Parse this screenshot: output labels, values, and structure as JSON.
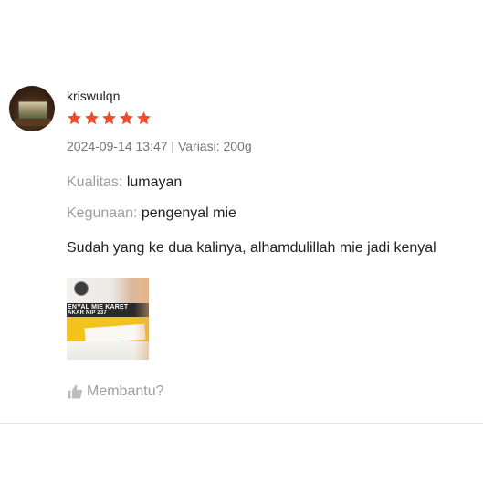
{
  "review": {
    "username": "kriswulqn",
    "rating": 5,
    "rating_max": 5,
    "star_color": "#ee4d2d",
    "meta": "2024-09-14 13:47 | Variasi: 200g",
    "attributes": [
      {
        "key": "Kualitas:",
        "value": "lumayan"
      },
      {
        "key": "Kegunaan:",
        "value": "pengenyal mie"
      }
    ],
    "comment": "Sudah yang ke dua kalinya, alhamdulillah mie jadi kenyal",
    "photo_text": {
      "line1": "ENYAL MIE KARET",
      "line2": "AKAR NIP 237"
    },
    "helpful_label": "Membantu?",
    "helpful_icon": "thumbs-up-icon"
  }
}
